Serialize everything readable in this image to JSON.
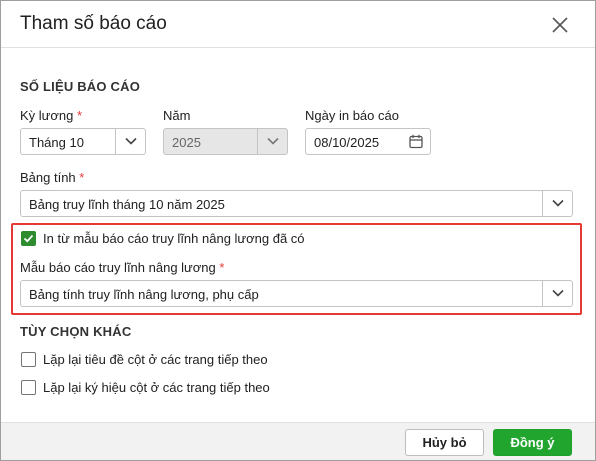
{
  "dialog": {
    "title": "Tham số báo cáo",
    "close_icon": "close-icon"
  },
  "report_data": {
    "section_title": "SỐ LIỆU BÁO CÁO",
    "pay_period": {
      "label": "Kỳ lương",
      "required": "*",
      "value": "Tháng 10"
    },
    "year": {
      "label": "Năm",
      "value": "2025"
    },
    "print_date": {
      "label": "Ngày in báo cáo",
      "value": "08/10/2025"
    },
    "spreadsheet": {
      "label": "Bảng tính",
      "required": "*",
      "value": "Bảng truy lĩnh tháng 10 năm 2025"
    },
    "print_from_template": {
      "label": "In từ mẫu báo cáo truy lĩnh nâng lương đã có",
      "checked": true
    },
    "template": {
      "label": "Mẫu báo cáo truy lĩnh nâng lương",
      "required": "*",
      "value": "Bảng tính truy lĩnh nâng lương, phụ cấp"
    }
  },
  "other_options": {
    "section_title": "TÙY CHỌN KHÁC",
    "repeat_column_titles": {
      "label": "Lặp lại tiêu đề cột ở các trang tiếp theo",
      "checked": false
    },
    "repeat_column_symbols": {
      "label": "Lặp lại ký hiệu cột ở các trang tiếp theo",
      "checked": false
    }
  },
  "footer": {
    "cancel_label": "Hủy bỏ",
    "ok_label": "Đồng ý"
  },
  "colors": {
    "accent_green": "#22a52f",
    "required_red": "#e53935",
    "highlight_red": "#e53935"
  }
}
